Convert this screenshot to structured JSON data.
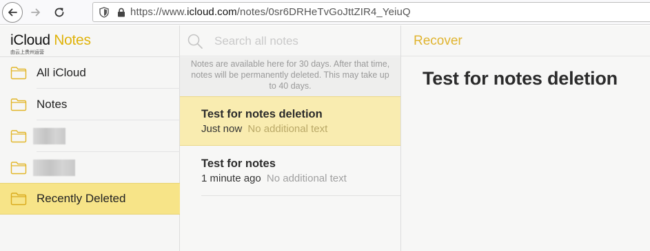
{
  "browser": {
    "url_prefix": "https://www.",
    "url_domain": "icloud.com",
    "url_path": "/notes/0sr6DRHeTvGoJttZIR4_YeiuQ"
  },
  "brand": {
    "title_part1": "iCloud",
    "title_part2": "Notes",
    "subtitle": "由云上贵州运营"
  },
  "sidebar": {
    "items": [
      {
        "label": "All iCloud",
        "redacted": false
      },
      {
        "label": "Notes",
        "redacted": false
      },
      {
        "label": "",
        "redacted": true
      },
      {
        "label": "",
        "redacted": true
      },
      {
        "label": "Recently Deleted",
        "redacted": false,
        "selected": true
      }
    ]
  },
  "notelist": {
    "search_placeholder": "Search all notes",
    "info_text": "Notes are available here for 30 days. After that time, notes will be permanently deleted. This may take up to 40 days.",
    "notes": [
      {
        "title": "Test for notes deletion",
        "time": "Just now",
        "snippet": "No additional text",
        "selected": true
      },
      {
        "title": "Test for notes",
        "time": "1 minute ago",
        "snippet": "No additional text",
        "selected": false
      }
    ]
  },
  "editor": {
    "recover_label": "Recover",
    "title": "Test for notes deletion"
  },
  "colors": {
    "accent": "#e0b30a",
    "selected_folder": "#f7e488",
    "selected_note": "#f9ecb0"
  }
}
